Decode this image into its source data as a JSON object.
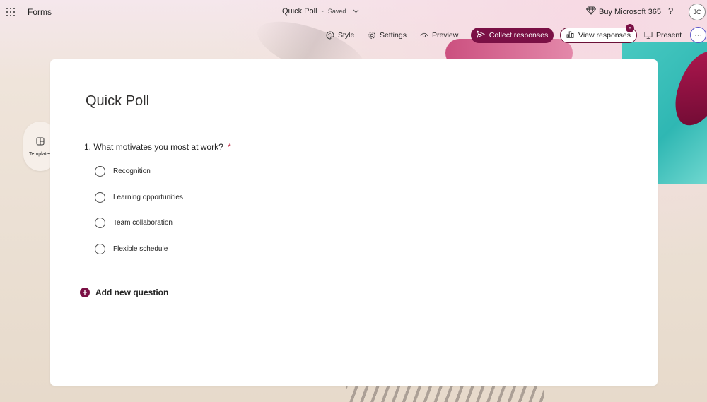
{
  "app": {
    "name": "Forms"
  },
  "document": {
    "title": "Quick Poll",
    "separator": "-",
    "status": "Saved"
  },
  "header": {
    "buy_label": "Buy Microsoft 365",
    "help_label": "?",
    "avatar_initials": "JC"
  },
  "toolbar": {
    "style_label": "Style",
    "settings_label": "Settings",
    "preview_label": "Preview",
    "collect_label": "Collect responses",
    "view_label": "View responses",
    "responses_count": "6",
    "present_label": "Present",
    "more_label": "···"
  },
  "sidebar": {
    "templates_label": "Templates"
  },
  "form": {
    "title": "Quick Poll",
    "questions": [
      {
        "number": "1.",
        "text": "What motivates you most at work?",
        "required_mark": "*",
        "options": [
          "Recognition",
          "Learning opportunities",
          "Team collaboration",
          "Flexible schedule"
        ]
      }
    ],
    "add_question_label": "Add new question"
  },
  "colors": {
    "accent": "#7a1045",
    "required": "#c4314b",
    "more_ring": "#5a56c8"
  }
}
